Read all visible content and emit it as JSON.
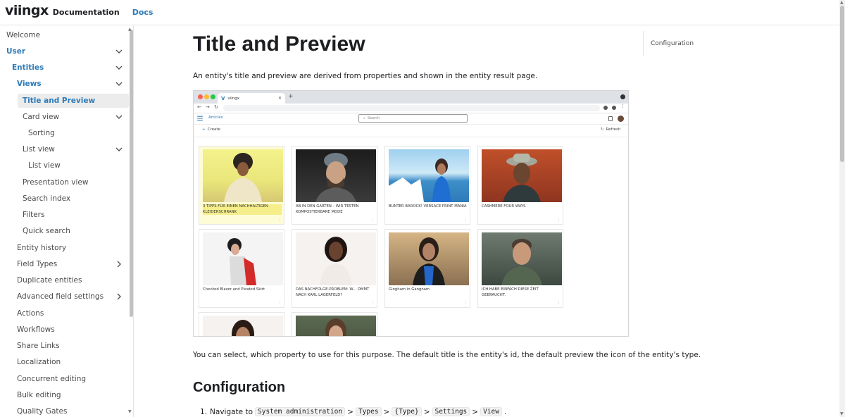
{
  "navbar": {
    "logo": "viingx",
    "title": "Documentation",
    "docs_link": "Docs"
  },
  "sidebar": {
    "items": [
      {
        "label": "Welcome"
      },
      {
        "label": "User",
        "chevron": "down"
      },
      {
        "label": "Entities",
        "chevron": "down"
      },
      {
        "label": "Views",
        "chevron": "down"
      },
      {
        "label": "Title and Preview"
      },
      {
        "label": "Card view",
        "chevron": "down"
      },
      {
        "label": "Sorting"
      },
      {
        "label": "List view",
        "chevron": "down"
      },
      {
        "label": "List view"
      },
      {
        "label": "Presentation view"
      },
      {
        "label": "Search index"
      },
      {
        "label": "Filters"
      },
      {
        "label": "Quick search"
      },
      {
        "label": "Entity history"
      },
      {
        "label": "Field Types",
        "chevron": "right"
      },
      {
        "label": "Duplicate entities"
      },
      {
        "label": "Advanced field settings",
        "chevron": "right"
      },
      {
        "label": "Actions"
      },
      {
        "label": "Workflows"
      },
      {
        "label": "Share Links"
      },
      {
        "label": "Localization"
      },
      {
        "label": "Concurrent editing"
      },
      {
        "label": "Bulk editing"
      },
      {
        "label": "Quality Gates"
      }
    ]
  },
  "main": {
    "title": "Title and Preview",
    "intro": "An entity's title and preview are derived from properties and shown in the entity result page.",
    "paragraph": "You can select, which property to use for this purpose. The default title is the entity's id, the default preview the icon of the entity's type.",
    "section_heading": "Configuration",
    "steps": {
      "number": "1.",
      "prefix": "Navigate to",
      "path": [
        "System administration",
        "Types",
        "{Type}",
        "Settings",
        "View"
      ],
      "separator": ">",
      "suffix": "."
    }
  },
  "toc": {
    "items": [
      "Configuration"
    ]
  },
  "screenshot": {
    "tab_logo": "V",
    "tab_title": "viingx",
    "app_nav": "Articles",
    "search_placeholder": "Search",
    "create_label": "Create",
    "refresh_label": "Refresh",
    "cards": [
      {
        "caption": "3 TIPPS FÜR EINEN NACHHALTIGEN KLEIDERSCHRANK",
        "highlighted": true
      },
      {
        "caption": "AB IN DEN GARTEN – WIR TESTEN KOMPOSTIERBARE MODE"
      },
      {
        "caption": "BUNTER BAROCK! VERSACE PRINT MANIA"
      },
      {
        "caption": "CASHMERE FOUR WAYS"
      },
      {
        "caption": "Checked Blazer and Pleated Skirt"
      },
      {
        "caption": "DAS NACHFOLGE-PROBLEM: W... OMMT NACH KARL LAGERFELD?"
      },
      {
        "caption": "Gingham in Gangnam"
      },
      {
        "caption": "ICH HABE EINFACH DIESE ZEIT GEBRAUCHT."
      },
      {
        "caption": ""
      },
      {
        "caption": ""
      }
    ]
  },
  "colors": {
    "accent": "#2e7bb8",
    "active_background": "#ececec",
    "highlight": "#f5ee8a"
  }
}
